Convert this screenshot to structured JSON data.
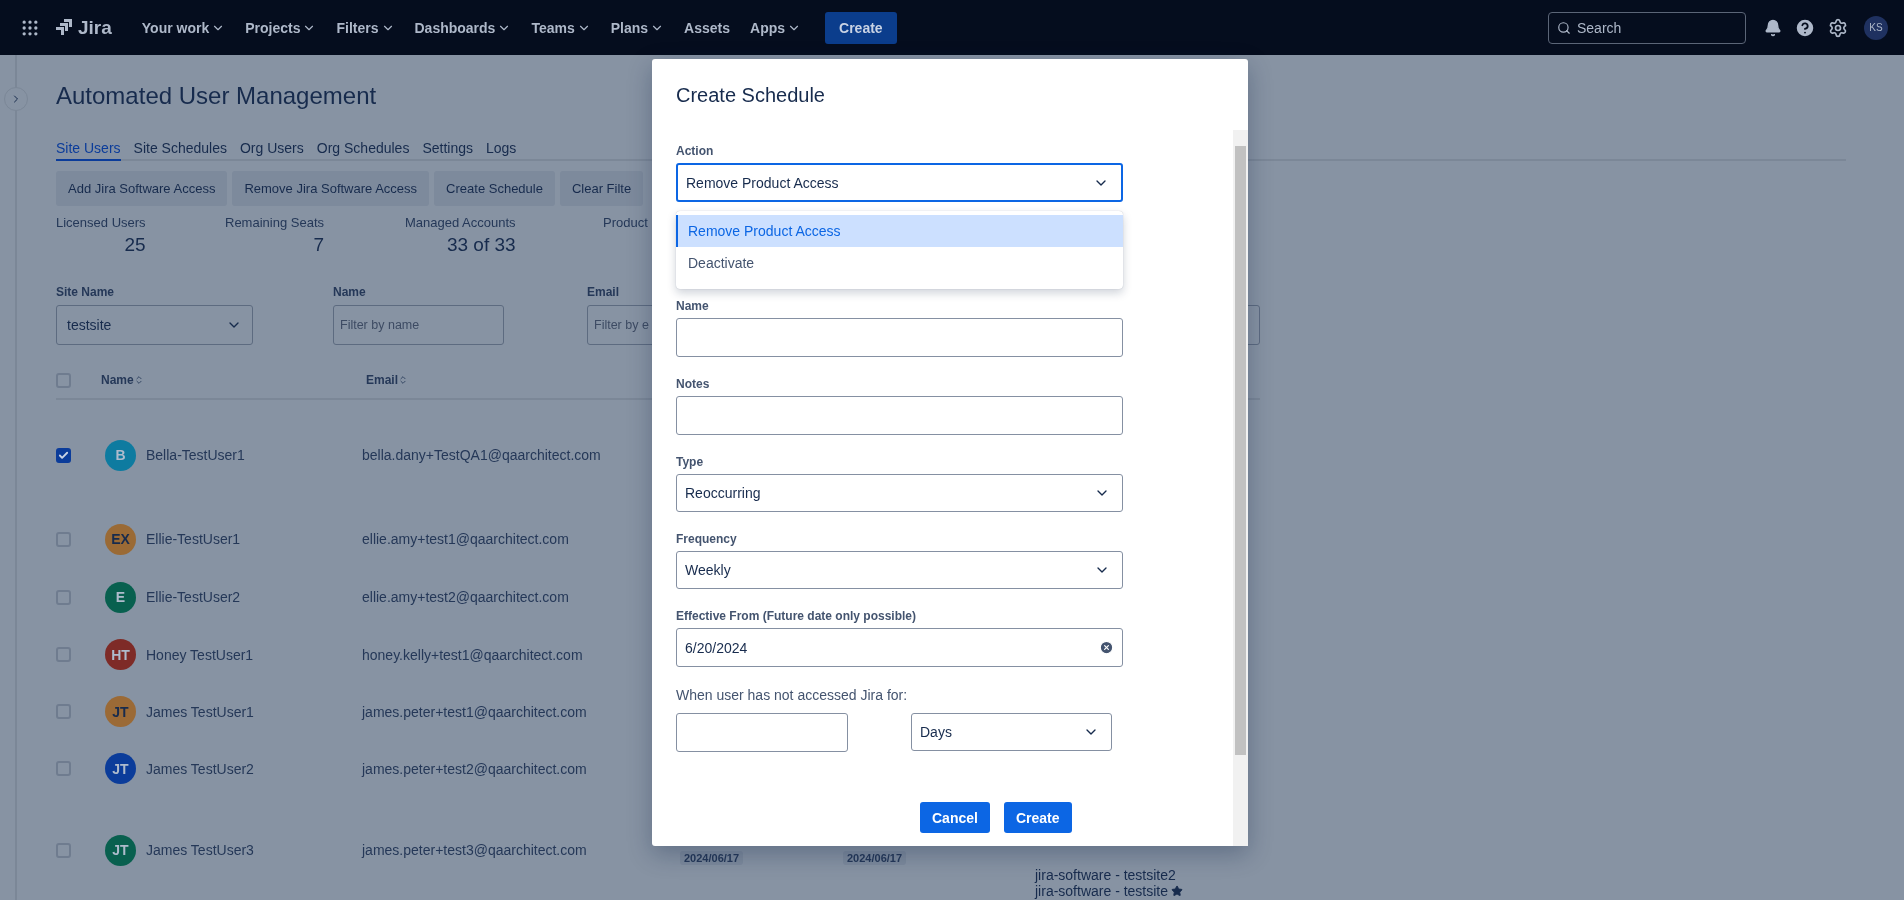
{
  "nav": {
    "product": "Jira",
    "items": [
      {
        "label": "Your work",
        "menu": true
      },
      {
        "label": "Projects",
        "menu": true
      },
      {
        "label": "Filters",
        "menu": true
      },
      {
        "label": "Dashboards",
        "menu": true
      },
      {
        "label": "Teams",
        "menu": true
      },
      {
        "label": "Plans",
        "menu": true
      },
      {
        "label": "Assets",
        "menu": false
      },
      {
        "label": "Apps",
        "menu": true
      }
    ],
    "create": "Create",
    "search": {
      "placeholder": "Search"
    },
    "avatar": "KS"
  },
  "page": {
    "title": "Automated User Management",
    "tabs": [
      {
        "label": "Site Users",
        "selected": true
      },
      {
        "label": "Site Schedules",
        "selected": false
      },
      {
        "label": "Org Users",
        "selected": false
      },
      {
        "label": "Org Schedules",
        "selected": false
      },
      {
        "label": "Settings",
        "selected": false
      },
      {
        "label": "Logs",
        "selected": false
      }
    ],
    "actions": [
      "Add Jira Software Access",
      "Remove Jira Software Access",
      "Create Schedule",
      "Clear Filte"
    ],
    "stats": [
      {
        "label": "Licensed Users",
        "value": "25"
      },
      {
        "label": "Remaining Seats",
        "value": "7"
      },
      {
        "label": "Managed Accounts",
        "value": "33 of 33"
      },
      {
        "label": "Product"
      }
    ],
    "filters": [
      {
        "kind": "select",
        "label": "Site Name",
        "value": "testsite"
      },
      {
        "kind": "input",
        "label": "Name",
        "placeholder": "Filter by name"
      },
      {
        "kind": "input",
        "label": "Email",
        "placeholder": "Filter by e"
      },
      {
        "kind": "input"
      }
    ],
    "table": {
      "header_checked": false,
      "columns": [
        {
          "label": "Name",
          "sortable": true
        },
        {
          "label": "Email",
          "sortable": true
        }
      ],
      "rows": [
        {
          "checked": true,
          "initials": "B",
          "color": "#0e7ba0",
          "name": "Bella-TestUser1",
          "email": "bella.dany+TestQA1@qaarchitect.com"
        },
        {
          "checked": false,
          "initials": "EX",
          "color": "#9a6a35",
          "name": "Ellie-TestUser1",
          "email": "ellie.amy+test1@qaarchitect.com"
        },
        {
          "checked": false,
          "initials": "E",
          "color": "#08604f",
          "name": "Ellie-TestUser2",
          "email": "ellie.amy+test2@qaarchitect.com"
        },
        {
          "checked": false,
          "initials": "HT",
          "color": "#7e2b27",
          "name": "Honey TestUser1",
          "email": "honey.kelly+test1@qaarchitect.com"
        },
        {
          "checked": false,
          "initials": "JT",
          "color": "#9b6a36",
          "name": "James TestUser1",
          "email": "james.peter+test1@qaarchitect.com"
        },
        {
          "checked": false,
          "initials": "JT",
          "color": "#0b3c9a",
          "name": "James TestUser2",
          "email": "james.peter+test2@qaarchitect.com"
        },
        {
          "checked": false,
          "initials": "JT",
          "color": "#09604f",
          "name": "James TestUser3",
          "email": "james.peter+test3@qaarchitect.com",
          "dates": [
            "2024/06/17",
            "2024/06/17"
          ],
          "products": [
            {
              "label": "jira-software - testsite2",
              "starred": false
            },
            {
              "label": "jira-software - testsite",
              "starred": true
            }
          ]
        }
      ]
    }
  },
  "modal": {
    "title": "Create Schedule",
    "fields": [
      {
        "kind": "select",
        "label": "Action",
        "value": "Remove Product Access",
        "focused": true,
        "open": true,
        "options": [
          {
            "label": "Remove Product Access",
            "selected": true
          },
          {
            "label": "Deactivate",
            "selected": false
          }
        ]
      },
      {
        "kind": "input",
        "label": "Name",
        "focused": false
      },
      {
        "kind": "input",
        "label": "Notes",
        "focused": false
      },
      {
        "kind": "select",
        "label": "Type",
        "value": "Reoccurring",
        "focused": false
      },
      {
        "kind": "select",
        "label": "Frequency",
        "value": "Weekly",
        "focused": false
      },
      {
        "kind": "date",
        "label": "Effective From (Future date only possible)",
        "value": "6/20/2024",
        "focused": false
      }
    ],
    "inactivity": {
      "label": "When user has not accessed Jira for:",
      "unit": "Days"
    },
    "buttons": [
      "Cancel",
      "Create"
    ]
  }
}
